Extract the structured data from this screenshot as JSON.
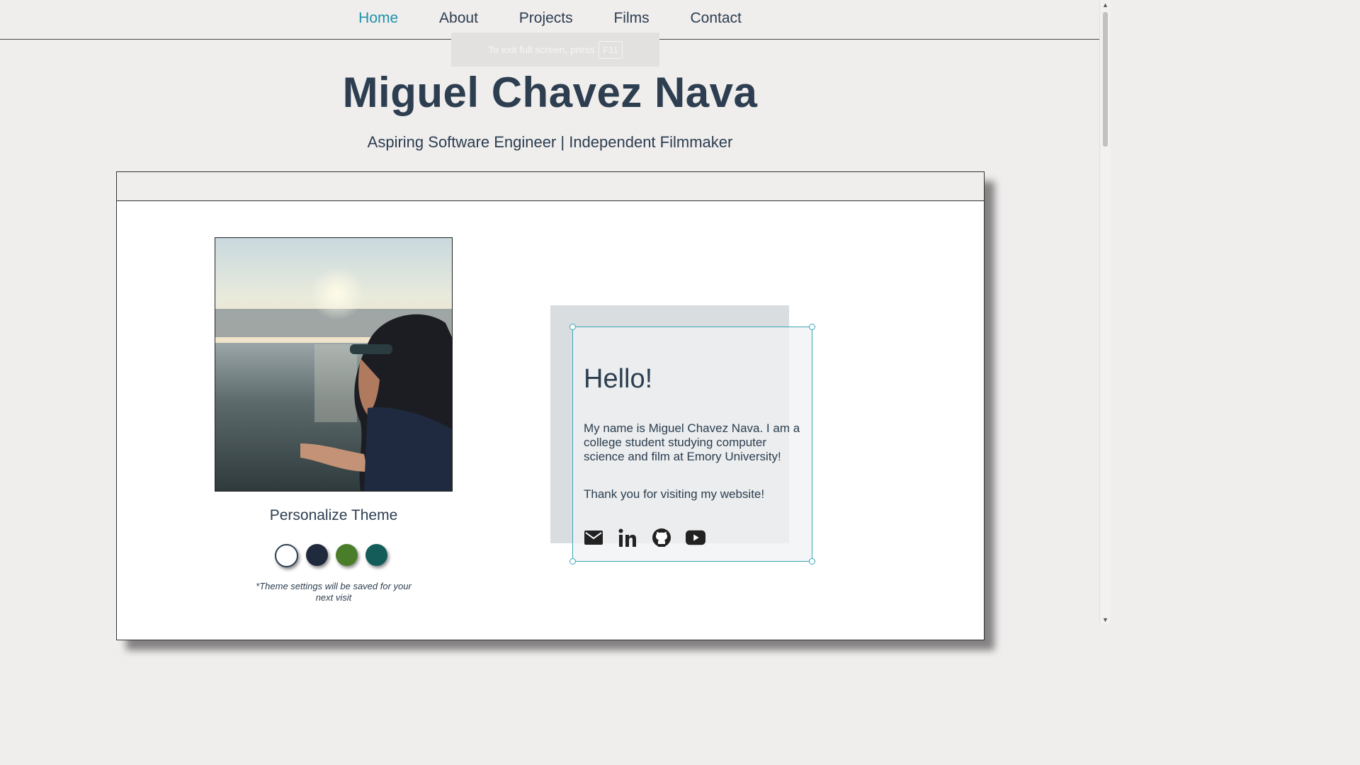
{
  "nav": {
    "items": [
      {
        "label": "Home",
        "active": true
      },
      {
        "label": "About",
        "active": false
      },
      {
        "label": "Projects",
        "active": false
      },
      {
        "label": "Films",
        "active": false
      },
      {
        "label": "Contact",
        "active": false
      }
    ]
  },
  "fullscreen_notice": {
    "text": "To exit full screen, press",
    "key": "F11"
  },
  "header": {
    "title": "Miguel Chavez Nava",
    "subtitle": "Aspiring Software Engineer | Independent Filmmaker"
  },
  "theme": {
    "label": "Personalize Theme",
    "note": "*Theme settings will be saved for your next visit",
    "swatches": [
      {
        "name": "white",
        "color": "#ffffff"
      },
      {
        "name": "navy",
        "color": "#1f2a3c"
      },
      {
        "name": "green",
        "color": "#4a7d2a"
      },
      {
        "name": "teal",
        "color": "#145c5a"
      }
    ]
  },
  "hello": {
    "title": "Hello!",
    "body": "My name is Miguel Chavez Nava. I am a college student studying computer science and film at Emory University!",
    "thanks": "Thank you for visiting my website!"
  },
  "socials": [
    "email-icon",
    "linkedin-icon",
    "github-icon",
    "youtube-icon"
  ],
  "colors": {
    "accent": "#1f93ab",
    "text": "#2c3e50",
    "page_bg": "#f0eded"
  }
}
